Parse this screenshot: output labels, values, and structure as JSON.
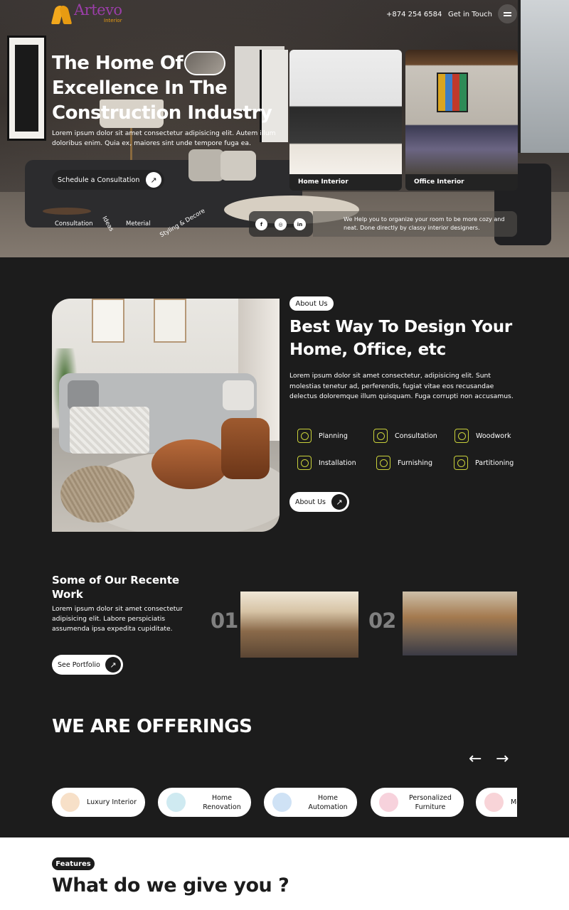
{
  "header": {
    "brand": "Artevo",
    "brand_sub": "Interior",
    "phone": "+874 254 6584",
    "get_in_touch": "Get in Touch"
  },
  "hero": {
    "title": "The Home Of Excellence In The Construction Industry",
    "description": "Lorem ipsum dolor sit amet consectetur adipisicing elit. Autem illum doloribus enim. Quia ex, maiores sint unde tempore fuga ea.",
    "cta": "Schedule a Consultation",
    "tags": [
      "Consultation",
      "Ideas",
      "Meterial",
      "Styling & Decore"
    ],
    "cards": [
      {
        "label": "Home Interior"
      },
      {
        "label": "Office Interior"
      }
    ],
    "social": [
      "facebook-icon",
      "instagram-icon",
      "linkedin-icon"
    ],
    "help_text": "We Help you to organize your room to be more cozy and neat. Done directly by classy interior designers."
  },
  "about": {
    "pill": "About Us",
    "title": "Best Way To Design Your Home, Office, etc",
    "description": "Lorem ipsum dolor sit amet consectetur, adipisicing elit. Sunt molestias tenetur ad, perferendis, fugiat vitae eos recusandae delectus doloremque illum quisquam. Fuga corrupti non accusamus.",
    "services": [
      {
        "label": "Planning",
        "icon": "planning-icon"
      },
      {
        "label": "Consultation",
        "icon": "consultation-icon"
      },
      {
        "label": "Woodwork",
        "icon": "woodwork-icon"
      },
      {
        "label": "Installation",
        "icon": "installation-icon"
      },
      {
        "label": "Furnishing",
        "icon": "furnishing-icon"
      },
      {
        "label": "Partitioning",
        "icon": "partitioning-icon"
      }
    ],
    "button": "About Us"
  },
  "work": {
    "title": "Some of Our Recente Work",
    "description": "Lorem ipsum dolor sit amet consectetur adipisicing elit. Labore perspiciatis assumenda ipsa expedita cupiditate.",
    "button": "See Portfolio",
    "items": [
      {
        "num": "01"
      },
      {
        "num": "02"
      }
    ]
  },
  "offerings": {
    "title": "WE ARE OFFERINGS",
    "prev": "←",
    "next": "→",
    "items": [
      {
        "label": "Luxury Interior",
        "color": "#e8a46a"
      },
      {
        "label": "Home Renovation",
        "color": "#8ecfe0"
      },
      {
        "label": "Home Automation",
        "color": "#5aa0d8"
      },
      {
        "label": "Personalized Furniture",
        "color": "#e87a9a"
      },
      {
        "label": "Me",
        "color": "#e85a6a"
      }
    ]
  },
  "features": {
    "pill": "Features",
    "title": "What do we give you ?"
  },
  "colors": {
    "background": "#1c1c1c",
    "accent_icon": "#c9d13a",
    "brand_purple": "#9a3ea8",
    "brand_orange": "#e79b12"
  }
}
